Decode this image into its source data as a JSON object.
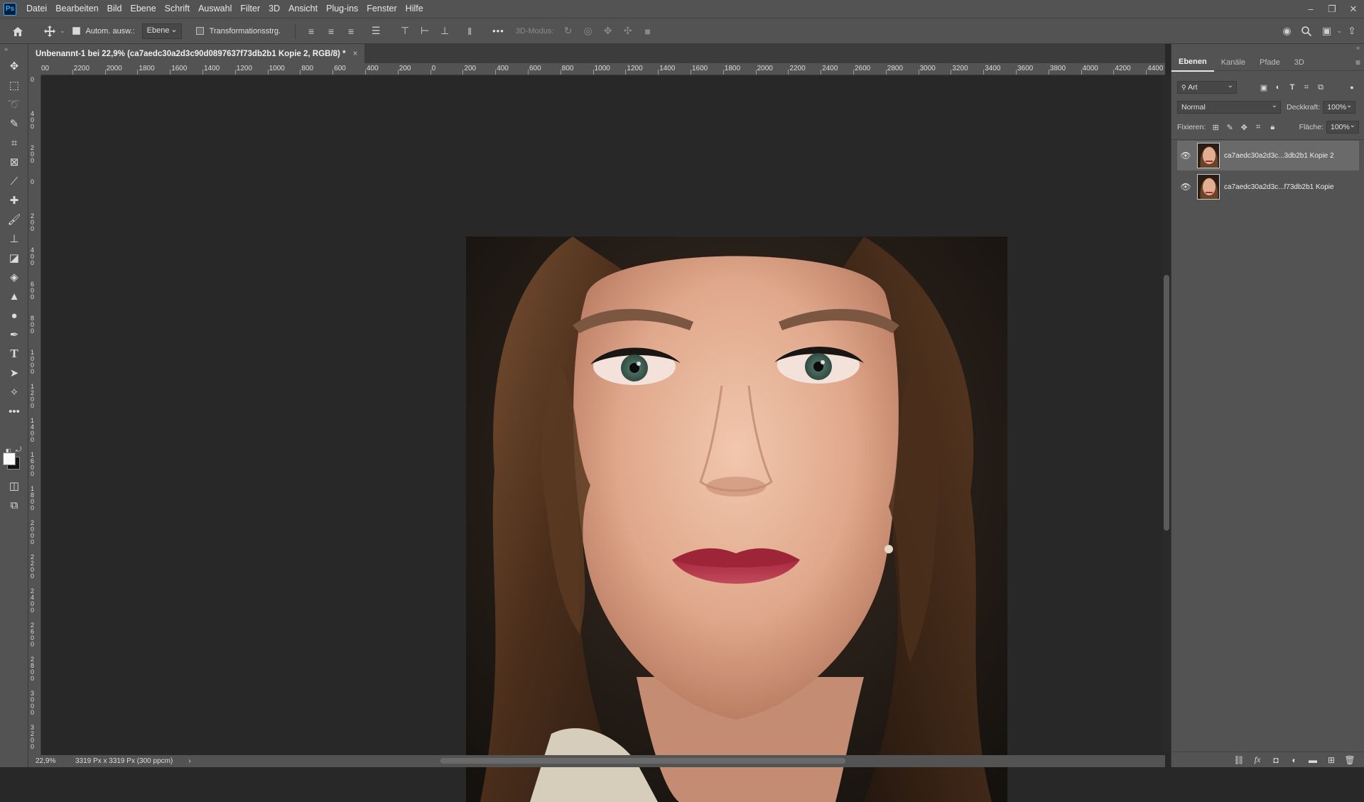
{
  "app": {
    "logo": "Ps",
    "menu": [
      "Datei",
      "Bearbeiten",
      "Bild",
      "Ebene",
      "Schrift",
      "Auswahl",
      "Filter",
      "3D",
      "Ansicht",
      "Plug-ins",
      "Fenster",
      "Hilfe"
    ],
    "window_controls": [
      "–",
      "❐",
      "✕"
    ]
  },
  "options": {
    "auto_select_label": "Autom. ausw.:",
    "auto_select_value": "Ebene",
    "transform_label": "Transformationsstrg.",
    "more": "•••",
    "mode3d_label": "3D-Modus:"
  },
  "document": {
    "tab_title": "Unbenannt-1 bei 22,9% (ca7aedc30a2d3c90d0897637f73db2b1 Kopie 2, RGB/8) *",
    "close": "×",
    "zoom": "22,9%",
    "size_info": "3319 Px x 3319 Px (300 ppcm)",
    "status_arrow": "›"
  },
  "rulers": {
    "h_labels": [
      "00",
      "2200",
      "2000",
      "1800",
      "1600",
      "1400",
      "1200",
      "1000",
      "800",
      "600",
      "400",
      "200",
      "0",
      "200",
      "400",
      "600",
      "800",
      "1000",
      "1200",
      "1400",
      "1600",
      "1800",
      "2000",
      "2200",
      "2400",
      "2600",
      "2800",
      "3000",
      "3200",
      "3400",
      "3600",
      "3800",
      "4000",
      "4200",
      "4400"
    ],
    "v_labels": [
      "0",
      "4 0 0",
      "2 0 0",
      "0",
      "2 0 0",
      "4 0 0",
      "6 0 0",
      "8 0 0",
      "1 0 0 0",
      "1 2 0 0",
      "1 4 0 0",
      "1 6 0 0",
      "1 8 0 0",
      "2 0 0 0",
      "2 2 0 0",
      "2 4 0 0",
      "2 6 0 0",
      "2 8 0 0",
      "3 0 0 0",
      "3 2 0 0"
    ]
  },
  "layers_panel": {
    "tabs": [
      "Ebenen",
      "Kanäle",
      "Pfade",
      "3D"
    ],
    "filter_label": "Art",
    "blend_mode": "Normal",
    "opacity_label": "Deckkraft:",
    "opacity_value": "100%",
    "lock_label": "Fixieren:",
    "fill_label": "Fläche:",
    "fill_value": "100%",
    "layers": [
      {
        "name": "ca7aedc30a2d3c...3db2b1 Kopie 2",
        "visible": true,
        "selected": true
      },
      {
        "name": "ca7aedc30a2d3c...f73db2b1 Kopie",
        "visible": true,
        "selected": false
      }
    ]
  },
  "colors": {
    "ui_panel": "#535353",
    "canvas_bg": "#282828",
    "accent_ps": "#31a8ff"
  }
}
